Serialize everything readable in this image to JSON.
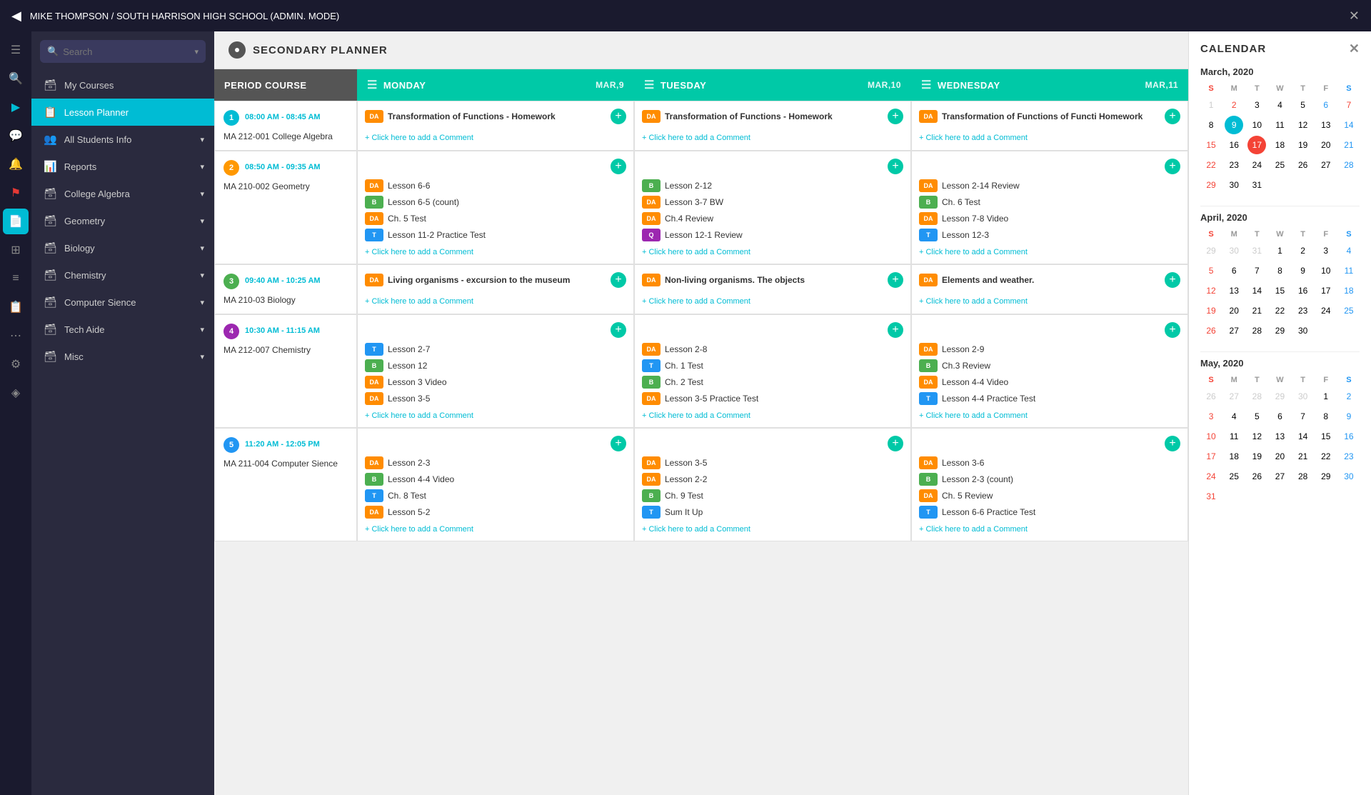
{
  "topbar": {
    "title": "MIKE THOMPSON / SOUTH HARRISON HIGH SCHOOL (ADMIN. MODE)",
    "back_icon": "◀",
    "close_icon": "✕"
  },
  "sidebar": {
    "search_placeholder": "Search",
    "items": [
      {
        "id": "my-courses",
        "label": "My Courses",
        "icon": "🗃",
        "active": false
      },
      {
        "id": "lesson-planner",
        "label": "Lesson Planner",
        "icon": "📋",
        "active": true
      },
      {
        "id": "all-students",
        "label": "All Students Info",
        "icon": "👥",
        "active": false
      },
      {
        "id": "reports",
        "label": "Reports",
        "icon": "📊",
        "active": false
      },
      {
        "id": "college-algebra",
        "label": "College Algebra",
        "icon": "🗃",
        "active": false
      },
      {
        "id": "geometry",
        "label": "Geometry",
        "icon": "🗃",
        "active": false
      },
      {
        "id": "biology",
        "label": "Biology",
        "icon": "🗃",
        "active": false
      },
      {
        "id": "chemistry",
        "label": "Chemistry",
        "icon": "🗃",
        "active": false
      },
      {
        "id": "computer-science",
        "label": "Computer Sience",
        "icon": "🗃",
        "active": false
      },
      {
        "id": "tech-aide",
        "label": "Tech Aide",
        "icon": "🗃",
        "active": false
      },
      {
        "id": "misc",
        "label": "Misc",
        "icon": "🗃",
        "active": false
      }
    ]
  },
  "planner": {
    "title": "SECONDARY PLANNER",
    "columns": [
      {
        "id": "period",
        "label": "PERIOD COURSE",
        "type": "period"
      },
      {
        "id": "monday",
        "label": "MONDAY",
        "date": "MAR,9",
        "type": "day"
      },
      {
        "id": "tuesday",
        "label": "TUESDAY",
        "date": "MAR,10",
        "type": "day"
      },
      {
        "id": "wednesday",
        "label": "WEDNESDAY",
        "date": "MAR,11",
        "type": "day"
      }
    ],
    "periods": [
      {
        "number": 1,
        "color": "#00bcd4",
        "time": "08:00 AM - 08:45 AM",
        "course": "MA 212-001 College Algebra",
        "monday": {
          "main": "Transformation of Functions - Homework",
          "badge": "DA",
          "badge_color": "badge-da",
          "lessons": []
        },
        "tuesday": {
          "main": "Transformation of Functions - Homework",
          "badge": "DA",
          "badge_color": "badge-da",
          "lessons": []
        },
        "wednesday": {
          "main": "Transformation of Functions of Functi Homework",
          "badge": "DA",
          "badge_color": "badge-da",
          "lessons": []
        }
      },
      {
        "number": 2,
        "color": "#ff9800",
        "time": "08:50 AM - 09:35 AM",
        "course": "MA 210-002 Geometry",
        "monday": {
          "main": "",
          "lessons": [
            {
              "badge": "DA",
              "badge_color": "badge-da",
              "text": "Lesson 6-6"
            },
            {
              "badge": "B",
              "badge_color": "badge-b",
              "text": "Lesson 6-5 (count)"
            },
            {
              "badge": "DA",
              "badge_color": "badge-da",
              "text": "Ch. 5 Test"
            },
            {
              "badge": "T",
              "badge_color": "badge-t",
              "text": "Lesson 11-2 Practice Test"
            }
          ]
        },
        "tuesday": {
          "main": "",
          "lessons": [
            {
              "badge": "B",
              "badge_color": "badge-b",
              "text": "Lesson 2-12"
            },
            {
              "badge": "DA",
              "badge_color": "badge-da",
              "text": "Lesson 3-7 BW"
            },
            {
              "badge": "DA",
              "badge_color": "badge-da",
              "text": "Ch.4 Review"
            },
            {
              "badge": "Q",
              "badge_color": "badge-q",
              "text": "Lesson 12-1 Review"
            }
          ]
        },
        "wednesday": {
          "main": "",
          "lessons": [
            {
              "badge": "DA",
              "badge_color": "badge-da",
              "text": "Lesson 2-14 Review"
            },
            {
              "badge": "B",
              "badge_color": "badge-b",
              "text": "Ch. 6 Test"
            },
            {
              "badge": "DA",
              "badge_color": "badge-da",
              "text": "Lesson 7-8 Video"
            },
            {
              "badge": "T",
              "badge_color": "badge-t",
              "text": "Lesson 12-3"
            }
          ]
        }
      },
      {
        "number": 3,
        "color": "#4caf50",
        "time": "09:40 AM - 10:25 AM",
        "course": "MA 210-03 Biology",
        "monday": {
          "main": "Living organisms - excursion to the museum",
          "badge": "DA",
          "badge_color": "badge-da",
          "lessons": []
        },
        "tuesday": {
          "main": "Non-living organisms. The objects",
          "badge": "DA",
          "badge_color": "badge-da",
          "lessons": []
        },
        "wednesday": {
          "main": "Elements and weather.",
          "badge": "DA",
          "badge_color": "badge-da",
          "lessons": []
        }
      },
      {
        "number": 4,
        "color": "#9c27b0",
        "time": "10:30 AM - 11:15 AM",
        "course": "MA 212-007 Chemistry",
        "monday": {
          "main": "",
          "lessons": [
            {
              "badge": "T",
              "badge_color": "badge-t",
              "text": "Lesson 2-7"
            },
            {
              "badge": "B",
              "badge_color": "badge-b",
              "text": "Lesson 12"
            },
            {
              "badge": "DA",
              "badge_color": "badge-da",
              "text": "Lesson 3 Video"
            },
            {
              "badge": "DA",
              "badge_color": "badge-da",
              "text": "Lesson 3-5"
            }
          ]
        },
        "tuesday": {
          "main": "",
          "lessons": [
            {
              "badge": "DA",
              "badge_color": "badge-da",
              "text": "Lesson 2-8"
            },
            {
              "badge": "T",
              "badge_color": "badge-t",
              "text": "Ch. 1 Test"
            },
            {
              "badge": "B",
              "badge_color": "badge-b",
              "text": "Ch. 2 Test"
            },
            {
              "badge": "DA",
              "badge_color": "badge-da",
              "text": "Lesson 3-5 Practice Test"
            }
          ]
        },
        "wednesday": {
          "main": "",
          "lessons": [
            {
              "badge": "DA",
              "badge_color": "badge-da",
              "text": "Lesson 2-9"
            },
            {
              "badge": "B",
              "badge_color": "badge-b",
              "text": "Ch.3 Review"
            },
            {
              "badge": "DA",
              "badge_color": "badge-da",
              "text": "Lesson 4-4 Video"
            },
            {
              "badge": "T",
              "badge_color": "badge-t",
              "text": "Lesson 4-4 Practice Test"
            }
          ]
        }
      },
      {
        "number": 5,
        "color": "#2196f3",
        "time": "11:20 AM - 12:05 PM",
        "course": "MA 211-004 Computer Sience",
        "monday": {
          "main": "",
          "lessons": [
            {
              "badge": "DA",
              "badge_color": "badge-da",
              "text": "Lesson 2-3"
            },
            {
              "badge": "B",
              "badge_color": "badge-b",
              "text": "Lesson 4-4 Video"
            },
            {
              "badge": "T",
              "badge_color": "badge-t",
              "text": "Ch. 8 Test"
            },
            {
              "badge": "DA",
              "badge_color": "badge-da",
              "text": "Lesson 5-2"
            }
          ]
        },
        "tuesday": {
          "main": "",
          "lessons": [
            {
              "badge": "DA",
              "badge_color": "badge-da",
              "text": "Lesson 3-5"
            },
            {
              "badge": "DA",
              "badge_color": "badge-da",
              "text": "Lesson 2-2"
            },
            {
              "badge": "B",
              "badge_color": "badge-b",
              "text": "Ch. 9 Test"
            },
            {
              "badge": "T",
              "badge_color": "badge-t",
              "text": "Sum It Up"
            }
          ]
        },
        "wednesday": {
          "main": "",
          "lessons": [
            {
              "badge": "DA",
              "badge_color": "badge-da",
              "text": "Lesson 3-6"
            },
            {
              "badge": "B",
              "badge_color": "badge-b",
              "text": "Lesson 2-3 (count)"
            },
            {
              "badge": "DA",
              "badge_color": "badge-da",
              "text": "Ch. 5 Review"
            },
            {
              "badge": "T",
              "badge_color": "badge-t",
              "text": "Lesson 6-6 Practice Test"
            }
          ]
        }
      }
    ]
  },
  "calendar": {
    "title": "CALENDAR",
    "close_icon": "✕",
    "months": [
      {
        "name": "March, 2020",
        "days_header": [
          "S",
          "M",
          "T",
          "W",
          "T",
          "F",
          "S"
        ],
        "start_dow": 0,
        "days": [
          {
            "d": 1,
            "type": "other-prev"
          },
          {
            "d": 2,
            "type": "sunday current",
            "selected": false,
            "today": false
          },
          {
            "d": 3,
            "type": "current"
          },
          {
            "d": 4,
            "type": "current"
          },
          {
            "d": 5,
            "type": "current"
          },
          {
            "d": 6,
            "type": "saturday current"
          },
          {
            "d": 7,
            "type": "sunday current"
          },
          {
            "d": 8,
            "type": "current"
          },
          {
            "d": 9,
            "type": "current selected"
          },
          {
            "d": 10,
            "type": "current"
          },
          {
            "d": 11,
            "type": "current"
          },
          {
            "d": 12,
            "type": "current"
          },
          {
            "d": 13,
            "type": "current"
          },
          {
            "d": 14,
            "type": "saturday current"
          },
          {
            "d": 15,
            "type": "sunday current"
          },
          {
            "d": 16,
            "type": "current"
          },
          {
            "d": 17,
            "type": "current today"
          },
          {
            "d": 18,
            "type": "current"
          },
          {
            "d": 19,
            "type": "current"
          },
          {
            "d": 20,
            "type": "current"
          },
          {
            "d": 21,
            "type": "saturday current"
          },
          {
            "d": 22,
            "type": "sunday current"
          },
          {
            "d": 23,
            "type": "current"
          },
          {
            "d": 24,
            "type": "current"
          },
          {
            "d": 25,
            "type": "current"
          },
          {
            "d": 26,
            "type": "current"
          },
          {
            "d": 27,
            "type": "current"
          },
          {
            "d": 28,
            "type": "saturday current"
          },
          {
            "d": 29,
            "type": "sunday current"
          },
          {
            "d": 30,
            "type": "current"
          },
          {
            "d": 31,
            "type": "current"
          }
        ]
      },
      {
        "name": "April, 2020",
        "days_header": [
          "S",
          "M",
          "T",
          "W",
          "T",
          "F",
          "S"
        ],
        "days": [
          {
            "d": 29,
            "type": "other-prev"
          },
          {
            "d": 30,
            "type": "other-prev"
          },
          {
            "d": 31,
            "type": "other-prev"
          },
          {
            "d": 1,
            "type": "current"
          },
          {
            "d": 2,
            "type": "current"
          },
          {
            "d": 3,
            "type": "current"
          },
          {
            "d": 4,
            "type": "saturday current"
          },
          {
            "d": 5,
            "type": "sunday current"
          },
          {
            "d": 6,
            "type": "current"
          },
          {
            "d": 7,
            "type": "current"
          },
          {
            "d": 8,
            "type": "current"
          },
          {
            "d": 9,
            "type": "current"
          },
          {
            "d": 10,
            "type": "current"
          },
          {
            "d": 11,
            "type": "saturday current"
          },
          {
            "d": 12,
            "type": "sunday current"
          },
          {
            "d": 13,
            "type": "current"
          },
          {
            "d": 14,
            "type": "current"
          },
          {
            "d": 15,
            "type": "current"
          },
          {
            "d": 16,
            "type": "current"
          },
          {
            "d": 17,
            "type": "current"
          },
          {
            "d": 18,
            "type": "saturday current"
          },
          {
            "d": 19,
            "type": "sunday current"
          },
          {
            "d": 20,
            "type": "current"
          },
          {
            "d": 21,
            "type": "current"
          },
          {
            "d": 22,
            "type": "current"
          },
          {
            "d": 23,
            "type": "current"
          },
          {
            "d": 24,
            "type": "current"
          },
          {
            "d": 25,
            "type": "saturday current"
          },
          {
            "d": 26,
            "type": "sunday current"
          },
          {
            "d": 27,
            "type": "current"
          },
          {
            "d": 28,
            "type": "current"
          },
          {
            "d": 29,
            "type": "current"
          },
          {
            "d": 30,
            "type": "current"
          }
        ]
      },
      {
        "name": "May, 2020",
        "days_header": [
          "S",
          "M",
          "T",
          "W",
          "T",
          "F",
          "S"
        ],
        "days": [
          {
            "d": 26,
            "type": "other-prev"
          },
          {
            "d": 27,
            "type": "other-prev"
          },
          {
            "d": 28,
            "type": "other-prev"
          },
          {
            "d": 29,
            "type": "other-prev"
          },
          {
            "d": 30,
            "type": "other-prev"
          },
          {
            "d": 1,
            "type": "current"
          },
          {
            "d": 2,
            "type": "saturday current"
          },
          {
            "d": 3,
            "type": "sunday current"
          },
          {
            "d": 4,
            "type": "current"
          },
          {
            "d": 5,
            "type": "current"
          },
          {
            "d": 6,
            "type": "current"
          },
          {
            "d": 7,
            "type": "current"
          },
          {
            "d": 8,
            "type": "current"
          },
          {
            "d": 9,
            "type": "saturday current"
          },
          {
            "d": 10,
            "type": "sunday current"
          },
          {
            "d": 11,
            "type": "current"
          },
          {
            "d": 12,
            "type": "current"
          },
          {
            "d": 13,
            "type": "current"
          },
          {
            "d": 14,
            "type": "current"
          },
          {
            "d": 15,
            "type": "current"
          },
          {
            "d": 16,
            "type": "saturday current"
          },
          {
            "d": 17,
            "type": "sunday current"
          },
          {
            "d": 18,
            "type": "current"
          },
          {
            "d": 19,
            "type": "current"
          },
          {
            "d": 20,
            "type": "current"
          },
          {
            "d": 21,
            "type": "current"
          },
          {
            "d": 22,
            "type": "current"
          },
          {
            "d": 23,
            "type": "saturday current"
          },
          {
            "d": 24,
            "type": "sunday current"
          },
          {
            "d": 25,
            "type": "current"
          },
          {
            "d": 26,
            "type": "current"
          },
          {
            "d": 27,
            "type": "current"
          },
          {
            "d": 28,
            "type": "current"
          },
          {
            "d": 29,
            "type": "current"
          },
          {
            "d": 30,
            "type": "saturday current"
          },
          {
            "d": 31,
            "type": "sunday current"
          }
        ]
      }
    ]
  },
  "ui": {
    "add_comment_label": "+ Click here to add a Comment",
    "period_course_label": "PERIOD COURSE",
    "secondary_planner_label": "SECONDARY PLANNER"
  },
  "icon_sidebar": {
    "icons": [
      {
        "id": "hamburger",
        "symbol": "☰",
        "active": false
      },
      {
        "id": "search",
        "symbol": "🔍",
        "active": false
      },
      {
        "id": "nav",
        "symbol": "▶",
        "active": false
      },
      {
        "id": "chat",
        "symbol": "💬",
        "active": false
      },
      {
        "id": "bell",
        "symbol": "🔔",
        "active": false
      },
      {
        "id": "flag",
        "symbol": "⚑",
        "active": false
      },
      {
        "id": "document",
        "symbol": "📄",
        "active": true,
        "highlight": "blue-active"
      },
      {
        "id": "grid",
        "symbol": "⊞",
        "active": false
      },
      {
        "id": "list",
        "symbol": "☰",
        "active": false
      },
      {
        "id": "file",
        "symbol": "📋",
        "active": false
      },
      {
        "id": "dots",
        "symbol": "⋯",
        "active": false
      },
      {
        "id": "settings",
        "symbol": "⚙",
        "active": false
      },
      {
        "id": "shape",
        "symbol": "◈",
        "active": false
      }
    ]
  }
}
